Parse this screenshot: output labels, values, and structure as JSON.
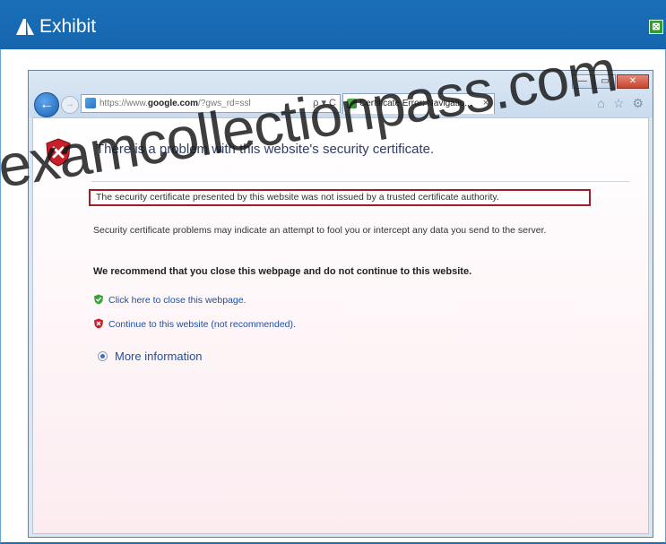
{
  "exhibit": {
    "title": "Exhibit",
    "close_glyph": "⊠"
  },
  "browser": {
    "window_controls": {
      "minimize": "—",
      "maximize": "▭",
      "close": "✕"
    },
    "back_glyph": "←",
    "forward_glyph": "→",
    "address": {
      "prefix": "https://www.",
      "domain": "google.com",
      "suffix": "/?gws_rd=ssl",
      "tools": "ρ ▾ C"
    },
    "tab": {
      "label": "Certificate Error: Navigatio...",
      "close": "×"
    },
    "toolbar_icons": [
      "home-icon",
      "favorites-star-icon",
      "tools-gear-icon"
    ]
  },
  "page": {
    "heading": "There is a problem with this website's security certificate.",
    "boxed_message": "The security certificate presented by this website was not issued by a trusted certificate authority.",
    "paragraph": "Security certificate problems may indicate an attempt to fool you or intercept any data you send to the server.",
    "recommendation": "We recommend that you close this webpage and do not continue to this website.",
    "link_close": "Click here to close this webpage.",
    "link_continue": "Continue to this website (not recommended).",
    "more_info": "More information"
  },
  "watermark": "examcollectionpass.com",
  "colors": {
    "exhibit_blue": "#1565ad",
    "box_red": "#a21d25",
    "link_blue": "#1e4fa8"
  }
}
